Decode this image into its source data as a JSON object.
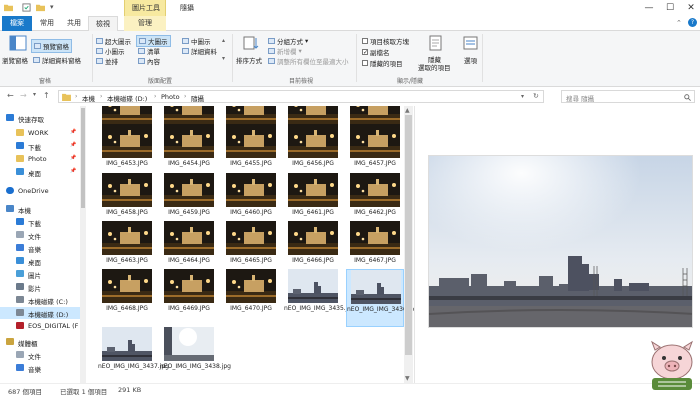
{
  "window": {
    "title": "隨攝",
    "context_group": "圖片工具",
    "controls": {
      "minimize": "—",
      "maximize": "☐",
      "close": "✕"
    }
  },
  "tabs": {
    "file": "檔案",
    "home": "常用",
    "share": "共用",
    "view": "檢視",
    "manage": "管理"
  },
  "ribbon": {
    "panes": {
      "nav_pane": "瀏覽窗格",
      "preview_pane": "預覽窗格",
      "details_pane": "詳細資料窗格",
      "group": "窗格"
    },
    "layout": {
      "items": [
        "超大圖示",
        "大圖示",
        "中圖示",
        "小圖示",
        "清單",
        "詳細資料",
        "並排",
        "內容"
      ],
      "group": "版面配置"
    },
    "current_view": {
      "sort": "排序方式",
      "group_by": "分組方式",
      "add_columns": "新增欄",
      "size_columns": "調整所有欄位至最適大小",
      "group": "目前檢視"
    },
    "show_hide": {
      "item_checkboxes": "項目核取方塊",
      "extensions": "副檔名",
      "hidden_items": "隱藏的項目",
      "hide_selected": "隱藏",
      "hide_selected2": "選取的項目",
      "options": "選項",
      "group": "顯示/隱藏"
    }
  },
  "navbar": {
    "breadcrumbs": [
      "本機",
      "本機磁碟 (D:)",
      "Photo",
      "隨攝"
    ],
    "search_placeholder": "搜尋 隨攝"
  },
  "sidebar": {
    "items": [
      {
        "label": "快速存取",
        "icon": "star-icon",
        "pinned": false
      },
      {
        "label": "WORK",
        "icon": "folder-icon",
        "pinned": true
      },
      {
        "label": "下載",
        "icon": "download-icon",
        "pinned": true
      },
      {
        "label": "Photo",
        "icon": "folder-icon",
        "pinned": true
      },
      {
        "label": "桌面",
        "icon": "desktop-icon",
        "pinned": true
      },
      {
        "label": "OneDrive",
        "icon": "cloud-icon",
        "pinned": false
      },
      {
        "label": "本機",
        "icon": "computer-icon",
        "pinned": false
      },
      {
        "label": "下載",
        "icon": "download-icon",
        "pinned": false
      },
      {
        "label": "文件",
        "icon": "document-icon",
        "pinned": false
      },
      {
        "label": "音樂",
        "icon": "music-icon",
        "pinned": false
      },
      {
        "label": "桌面",
        "icon": "desktop-icon",
        "pinned": false
      },
      {
        "label": "圖片",
        "icon": "picture-icon",
        "pinned": false
      },
      {
        "label": "影片",
        "icon": "video-icon",
        "pinned": false
      },
      {
        "label": "本機磁碟 (C:)",
        "icon": "drive-icon",
        "pinned": false
      },
      {
        "label": "本機磁碟 (D:)",
        "icon": "drive-icon",
        "pinned": false
      },
      {
        "label": "EOS_DIGITAL (F",
        "icon": "sd-card-icon",
        "pinned": false
      },
      {
        "label": "媒體櫃",
        "icon": "library-icon",
        "pinned": false
      },
      {
        "label": "文件",
        "icon": "document-icon",
        "pinned": false
      },
      {
        "label": "音樂",
        "icon": "music-icon",
        "pinned": false
      }
    ]
  },
  "files": [
    {
      "name": "IMG_6448.JPG",
      "kind": "night"
    },
    {
      "name": "IMG_6449.JPG",
      "kind": "night"
    },
    {
      "name": "IMG_6450.JPG",
      "kind": "night",
      "highlight": true
    },
    {
      "name": "IMG_6451.JPG",
      "kind": "night"
    },
    {
      "name": "IMG_6452.JPG",
      "kind": "night"
    },
    {
      "name": "IMG_6453.JPG",
      "kind": "night"
    },
    {
      "name": "IMG_6454.JPG",
      "kind": "night"
    },
    {
      "name": "IMG_6455.JPG",
      "kind": "night"
    },
    {
      "name": "IMG_6456.JPG",
      "kind": "night"
    },
    {
      "name": "IMG_6457.JPG",
      "kind": "night"
    },
    {
      "name": "IMG_6458.JPG",
      "kind": "night"
    },
    {
      "name": "IMG_6459.JPG",
      "kind": "night"
    },
    {
      "name": "IMG_6460.JPG",
      "kind": "night"
    },
    {
      "name": "IMG_6461.JPG",
      "kind": "night"
    },
    {
      "name": "IMG_6462.JPG",
      "kind": "night"
    },
    {
      "name": "IMG_6463.JPG",
      "kind": "night"
    },
    {
      "name": "IMG_6464.JPG",
      "kind": "night"
    },
    {
      "name": "IMG_6465.JPG",
      "kind": "night"
    },
    {
      "name": "IMG_6466.JPG",
      "kind": "night"
    },
    {
      "name": "IMG_6467.JPG",
      "kind": "night"
    },
    {
      "name": "IMG_6468.JPG",
      "kind": "night"
    },
    {
      "name": "IMG_6469.JPG",
      "kind": "night"
    },
    {
      "name": "IMG_6470.JPG",
      "kind": "night"
    },
    {
      "name": "nEO_IMG_IMG_3435.jpg",
      "kind": "day"
    },
    {
      "name": "nEO_IMG_IMG_3436.jpg",
      "kind": "day",
      "selected": true
    },
    {
      "name": "nEO_IMG_IMG_3437.jpg",
      "kind": "day"
    },
    {
      "name": "nEO_IMG_IMG_3438.jpg",
      "kind": "sun"
    }
  ],
  "status": {
    "count": "687 個項目",
    "selected": "已選取 1 個項目",
    "size": "291 KB"
  },
  "colors": {
    "accent": "#1979ca",
    "selection": "#cce8ff",
    "context": "#f7e9a0"
  }
}
